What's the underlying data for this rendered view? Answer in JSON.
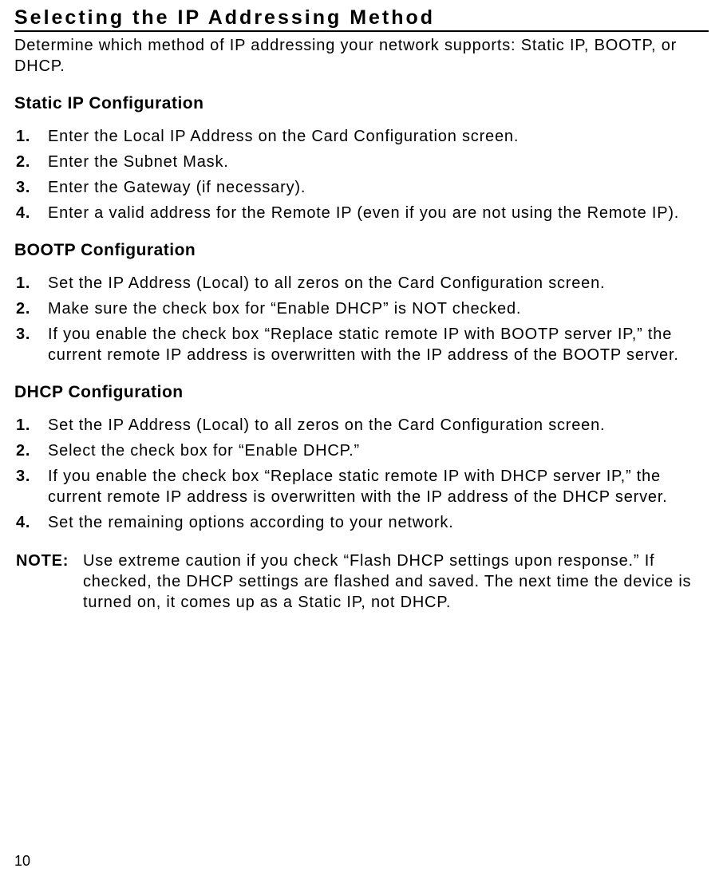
{
  "main_heading": "Selecting the IP Addressing Method",
  "intro": "Determine which method of IP addressing your network supports:  Static IP, BOOTP, or DHCP.",
  "sections": {
    "static": {
      "heading": "Static IP Configuration",
      "items": {
        "0": {
          "num": "1.",
          "text": "Enter the Local IP Address on the Card Configuration screen."
        },
        "1": {
          "num": "2.",
          "text": "Enter the Subnet Mask."
        },
        "2": {
          "num": "3.",
          "text": "Enter the Gateway (if necessary)."
        },
        "3": {
          "num": "4.",
          "text": "Enter a valid address for the Remote IP (even if you are not using the Remote IP)."
        }
      }
    },
    "bootp": {
      "heading": "BOOTP Configuration",
      "items": {
        "0": {
          "num": "1.",
          "text": "Set the IP Address (Local) to all zeros on the Card Configuration screen."
        },
        "1": {
          "num": "2.",
          "text": "Make sure the check box for “Enable DHCP” is NOT checked."
        },
        "2": {
          "num": "3.",
          "text": "If you enable the check box “Replace static remote IP with BOOTP server IP,” the current remote IP address is overwritten with the IP address of the BOOTP server."
        }
      }
    },
    "dhcp": {
      "heading": "DHCP Configuration",
      "items": {
        "0": {
          "num": "1.",
          "text": "Set the IP Address (Local) to all zeros on the Card Configuration screen."
        },
        "1": {
          "num": "2.",
          "text": "Select the check box for “Enable DHCP.”"
        },
        "2": {
          "num": "3.",
          "text": "If you enable the check box “Replace static remote IP with DHCP server IP,” the current remote IP address is overwritten with the IP address of the DHCP server."
        },
        "3": {
          "num": "4.",
          "text": "Set the remaining options according to your network."
        }
      }
    }
  },
  "note": {
    "label": "NOTE:",
    "text": "Use extreme caution if you check “Flash DHCP settings upon response.”  If checked, the DHCP settings are flashed and saved.  The next time the device is turned on, it comes up as a Static IP, not DHCP."
  },
  "page_number": "10"
}
